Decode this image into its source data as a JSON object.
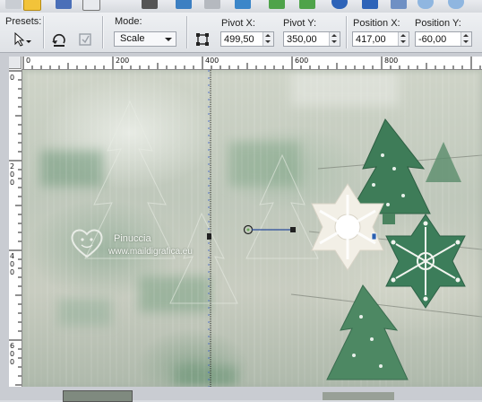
{
  "toolbar": {
    "presets_label": "Presets:",
    "mode_label": "Mode:",
    "mode_value": "Scale",
    "pivot_x_label": "Pivot X:",
    "pivot_x_value": "499,50",
    "pivot_y_label": "Pivot Y:",
    "pivot_y_value": "350,00",
    "position_x_label": "Position X:",
    "position_x_value": "417,00",
    "position_y_label": "Position Y:",
    "position_y_value": "-60,00",
    "icons": [
      "folder-icon",
      "floppy-icon",
      "print-icon",
      "export-icon",
      "undo-icon",
      "redo-icon",
      "help-icon",
      "zoom-icon",
      "pick-icon",
      "reset-icon",
      "fullscreen-icon",
      "pivot-icon"
    ]
  },
  "rulers": {
    "horizontal_labels": [
      "0",
      "200",
      "400",
      "600",
      "800"
    ],
    "vertical_labels": [
      "0",
      "200",
      "400",
      "600"
    ]
  },
  "watermark": {
    "name": "Pinuccia",
    "site": "www.maildigrafica.eu"
  },
  "colors": {
    "toolbar_bg": "#e2e5e9",
    "cookie_green": "#3f7a58",
    "accent_blue": "#2a5fb0"
  }
}
